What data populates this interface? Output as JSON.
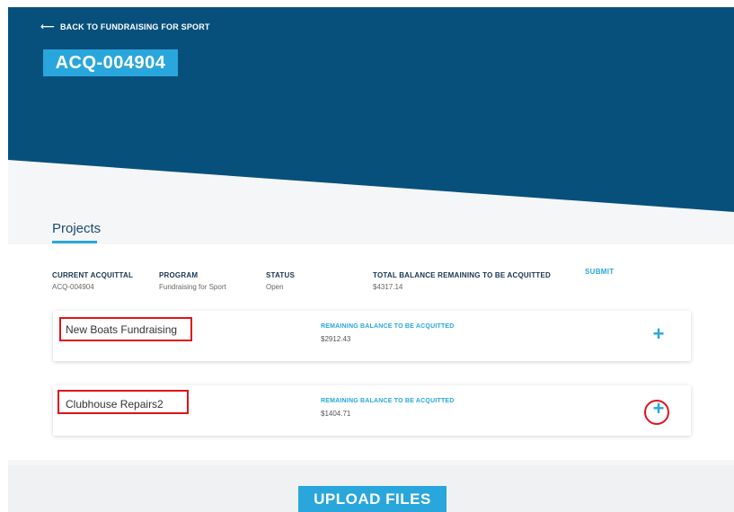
{
  "header": {
    "back_label": "BACK TO FUNDRAISING FOR SPORT",
    "reference": "ACQ-004904",
    "background_color": "#07507c",
    "accent_color": "#29a6dc"
  },
  "tabs": {
    "projects_label": "Projects"
  },
  "summary": {
    "current_acquittal": {
      "label": "CURRENT ACQUITTAL",
      "value": "ACQ-004904"
    },
    "program": {
      "label": "PROGRAM",
      "value": "Fundraising for Sport"
    },
    "status": {
      "label": "STATUS",
      "value": "Open"
    },
    "total_balance": {
      "label": "TOTAL BALANCE REMAINING TO BE ACQUITTED",
      "value": "$4317.14"
    },
    "submit_label": "SUBMIT"
  },
  "projects": [
    {
      "name": "New Boats Fundraising",
      "balance_label": "REMAINING BALANCE TO BE ACQUITTED",
      "balance_value": "$2912.43",
      "add_icon": "plus-icon"
    },
    {
      "name": "Clubhouse Repairs2",
      "balance_label": "REMAINING BALANCE TO BE ACQUITTED",
      "balance_value": "$1404.71",
      "add_icon": "plus-icon"
    }
  ],
  "upload": {
    "label": "UPLOAD FILES"
  },
  "annotations": {
    "highlight_color": "#e0131a"
  }
}
